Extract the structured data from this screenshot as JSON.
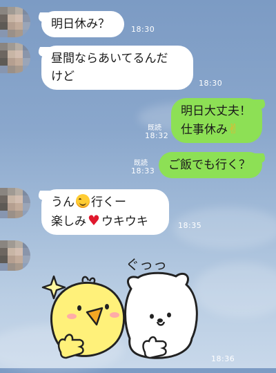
{
  "colors": {
    "background_top": "#7c9bc4",
    "incoming_bubble": "#ffffff",
    "outgoing_bubble": "#8de055",
    "timestamp_text": "#ffffff"
  },
  "messages": [
    {
      "type": "incoming",
      "text": "明日休み？",
      "time": "18:30"
    },
    {
      "type": "incoming",
      "lines": [
        "昼間ならあいてるんだ",
        "けど"
      ],
      "time": "18:30"
    },
    {
      "type": "outgoing",
      "lines": [
        "明日大丈夫！",
        "仕事休み"
      ],
      "emoji": "victory-hand-icon",
      "read": "既読",
      "time": "18:32"
    },
    {
      "type": "outgoing",
      "text": "ご飯でも行く？",
      "read": "既読",
      "time": "18:33"
    },
    {
      "type": "incoming",
      "line1_a": "うん",
      "line1_b": "行くー",
      "line2_a": "楽しみ",
      "line2_b": "ウキウキ",
      "emojis": [
        "smiling-face-icon",
        "red-heart-icon"
      ],
      "time": "18:35"
    },
    {
      "type": "incoming-sticker",
      "sticker": "chick-and-bear-thumbs-up-sticker",
      "sticker_text": "ぐっっ",
      "time": "18:36"
    }
  ]
}
